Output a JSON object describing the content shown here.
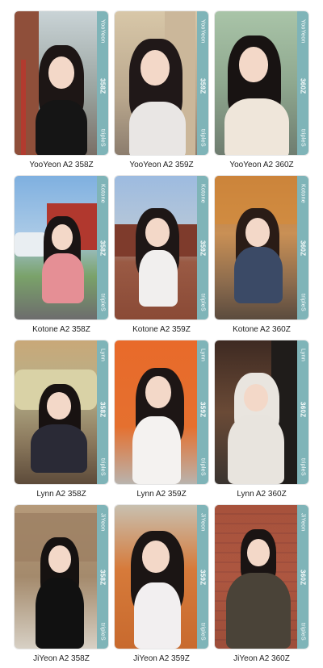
{
  "cards": [
    {
      "member": "YooYeon",
      "code": "358Z",
      "brand": "tripleS",
      "caption": "YooYeon A2 358Z"
    },
    {
      "member": "YooYeon",
      "code": "359Z",
      "brand": "tripleS",
      "caption": "YooYeon A2 359Z"
    },
    {
      "member": "YooYeon",
      "code": "360Z",
      "brand": "tripleS",
      "caption": "YooYeon A2 360Z"
    },
    {
      "member": "Kotone",
      "code": "358Z",
      "brand": "tripleS",
      "caption": "Kotone A2 358Z"
    },
    {
      "member": "Kotone",
      "code": "359Z",
      "brand": "tripleS",
      "caption": "Kotone A2 359Z"
    },
    {
      "member": "Kotone",
      "code": "360Z",
      "brand": "tripleS",
      "caption": "Kotone A2 360Z"
    },
    {
      "member": "Lynn",
      "code": "358Z",
      "brand": "tripleS",
      "caption": "Lynn A2 358Z"
    },
    {
      "member": "Lynn",
      "code": "359Z",
      "brand": "tripleS",
      "caption": "Lynn A2 359Z"
    },
    {
      "member": "Lynn",
      "code": "360Z",
      "brand": "tripleS",
      "caption": "Lynn A2 360Z"
    },
    {
      "member": "JiYeon",
      "code": "358Z",
      "brand": "tripleS",
      "caption": "JiYeon A2 358Z"
    },
    {
      "member": "JiYeon",
      "code": "359Z",
      "brand": "tripleS",
      "caption": "JiYeon A2 359Z"
    },
    {
      "member": "JiYeon",
      "code": "360Z",
      "brand": "tripleS",
      "caption": "JiYeon A2 360Z"
    }
  ],
  "colors": {
    "side_strip": "#7fb4b8"
  }
}
